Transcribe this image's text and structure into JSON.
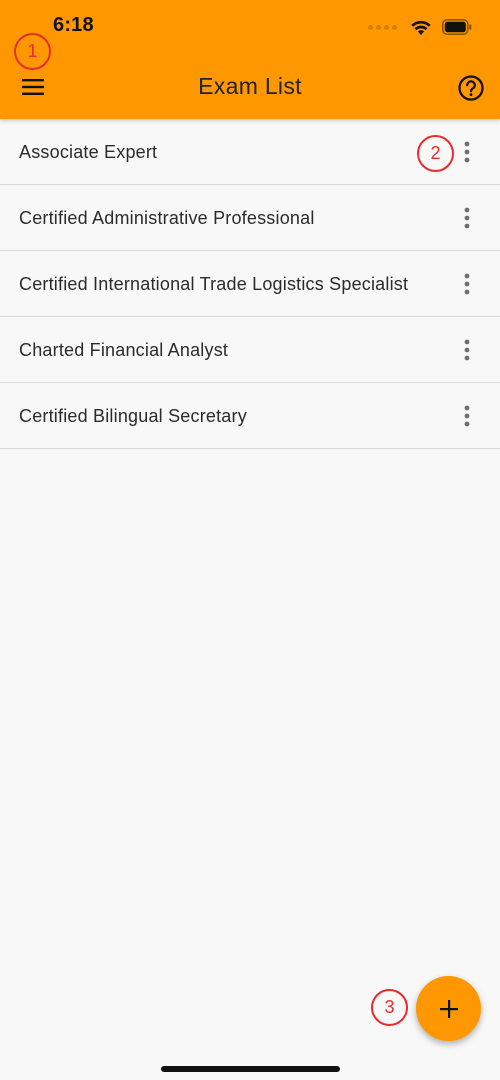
{
  "status_bar": {
    "time": "6:18",
    "signal_icon": "cellular-signal-icon",
    "wifi_icon": "wifi-icon",
    "battery_icon": "battery-icon"
  },
  "appbar": {
    "title": "Exam List",
    "menu_icon": "hamburger-menu-icon",
    "help_icon": "help-circle-icon",
    "background_color": "#ff9800"
  },
  "exams": [
    {
      "label": "Associate Expert"
    },
    {
      "label": "Certified Administrative Professional"
    },
    {
      "label": "Certified International Trade Logistics Specialist"
    },
    {
      "label": "Charted Financial Analyst"
    },
    {
      "label": "Certified Bilingual Secretary"
    }
  ],
  "item_action_icon": "more-vertical-icon",
  "fab": {
    "icon": "plus-icon",
    "color": "#ff9800"
  },
  "annotations": {
    "marker_1": "1",
    "marker_2": "2",
    "marker_3": "3",
    "color": "#e82b2b"
  }
}
